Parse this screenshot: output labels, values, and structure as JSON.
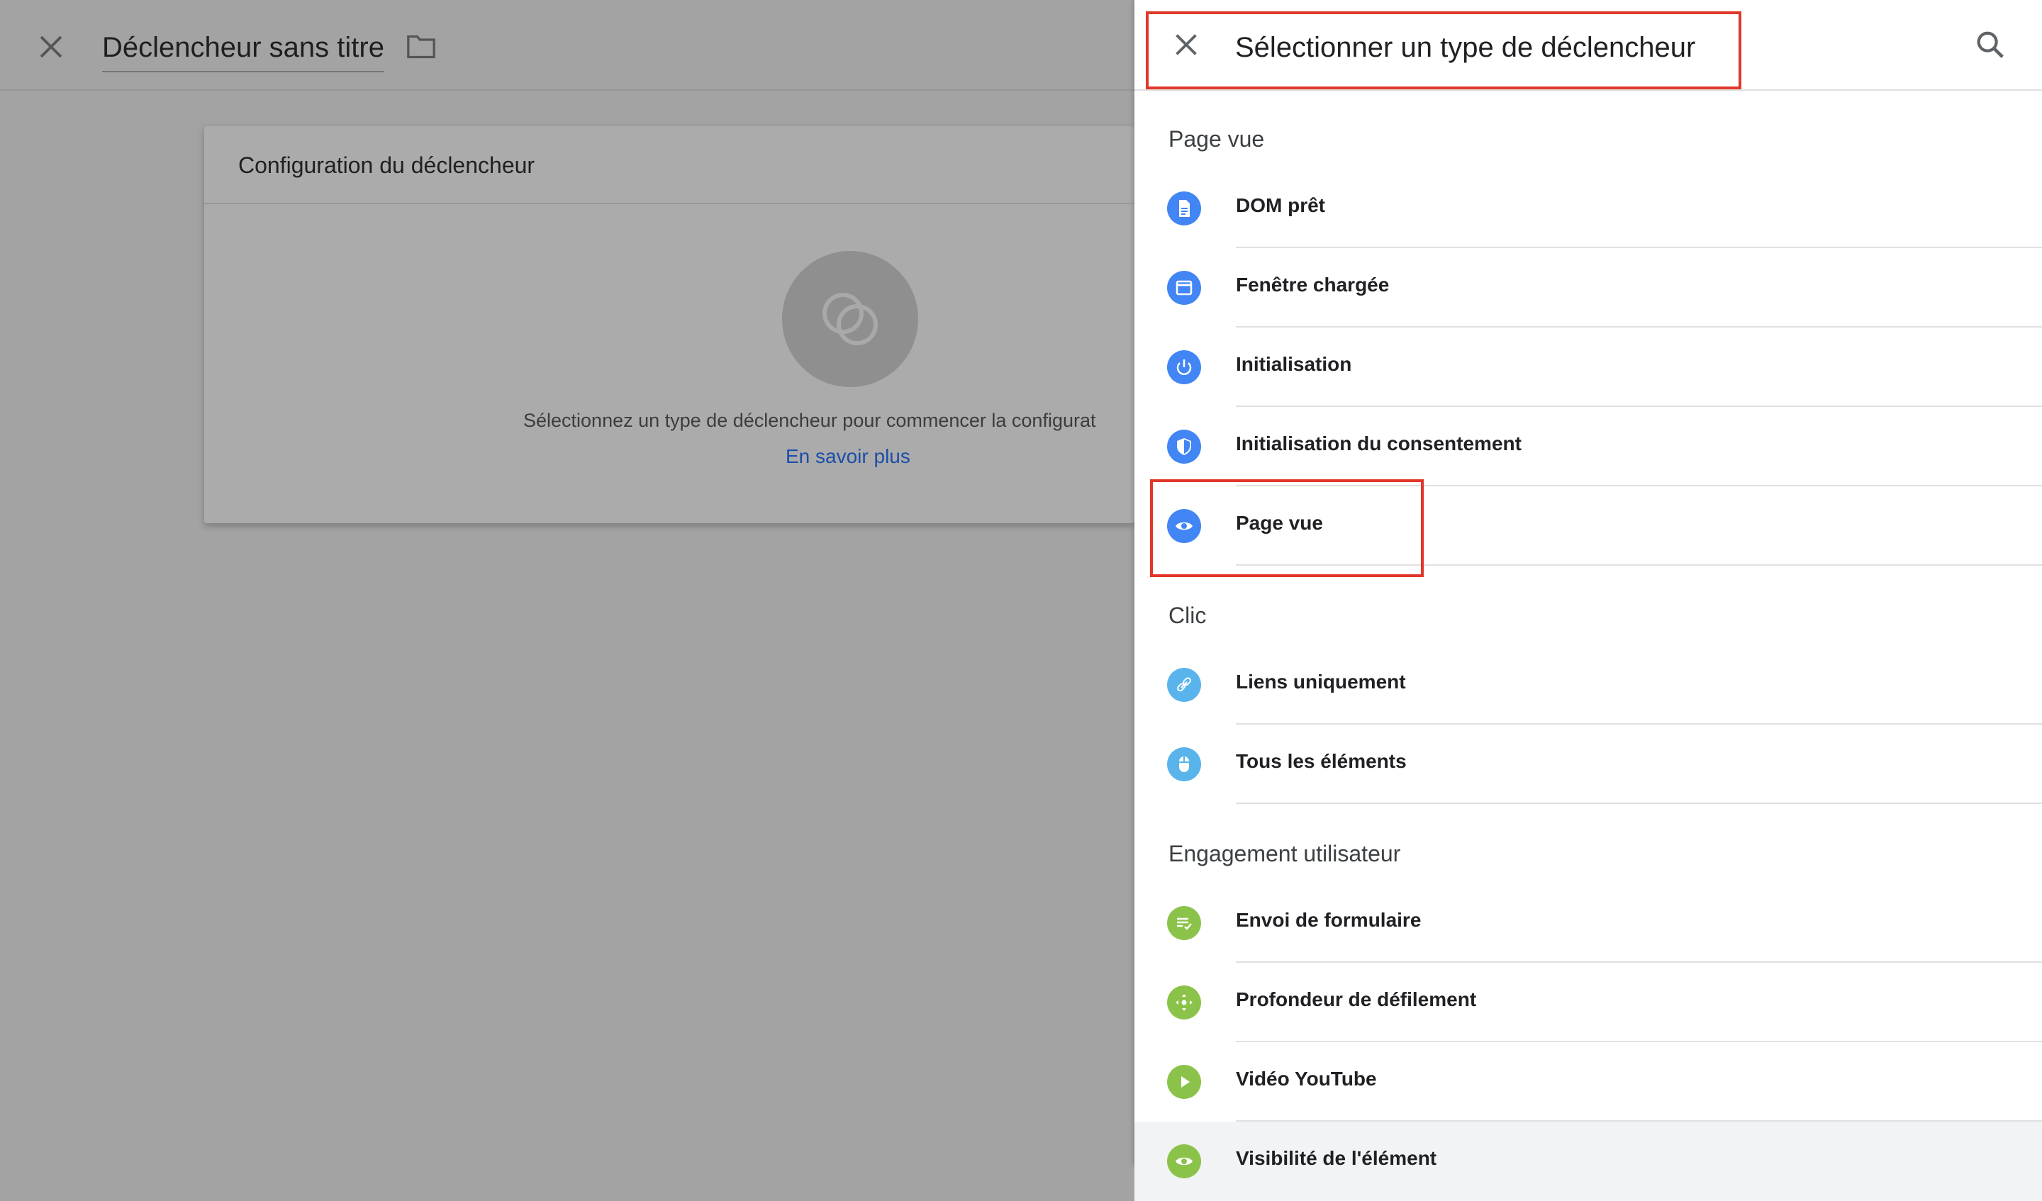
{
  "editor": {
    "title": "Déclencheur sans titre",
    "card_heading": "Configuration du déclencheur",
    "hint": "Sélectionnez un type de déclencheur pour commencer la configurat",
    "learn_more": "En savoir plus"
  },
  "panel": {
    "title": "Sélectionner un type de déclencheur",
    "sections": [
      {
        "label": "Page vue",
        "items": [
          {
            "label": "DOM prêt",
            "icon": "document-icon",
            "color": "#4285f4"
          },
          {
            "label": "Fenêtre chargée",
            "icon": "window-icon",
            "color": "#4285f4"
          },
          {
            "label": "Initialisation",
            "icon": "power-icon",
            "color": "#4285f4"
          },
          {
            "label": "Initialisation du consentement",
            "icon": "shield-icon",
            "color": "#4285f4"
          },
          {
            "label": "Page vue",
            "icon": "eye-icon",
            "color": "#4285f4"
          }
        ]
      },
      {
        "label": "Clic",
        "items": [
          {
            "label": "Liens uniquement",
            "icon": "link-icon",
            "color": "#5ab4ec"
          },
          {
            "label": "Tous les éléments",
            "icon": "mouse-icon",
            "color": "#5ab4ec"
          }
        ]
      },
      {
        "label": "Engagement utilisateur",
        "items": [
          {
            "label": "Envoi de formulaire",
            "icon": "form-icon",
            "color": "#8bc34a"
          },
          {
            "label": "Profondeur de défilement",
            "icon": "scroll-icon",
            "color": "#8bc34a"
          },
          {
            "label": "Vidéo YouTube",
            "icon": "play-icon",
            "color": "#8bc34a"
          },
          {
            "label": "Visibilité de l'élément",
            "icon": "eye-icon",
            "color": "#8bc34a"
          }
        ]
      }
    ]
  },
  "colors": {
    "highlight": "#e1372a",
    "link": "#1a4ea8"
  }
}
